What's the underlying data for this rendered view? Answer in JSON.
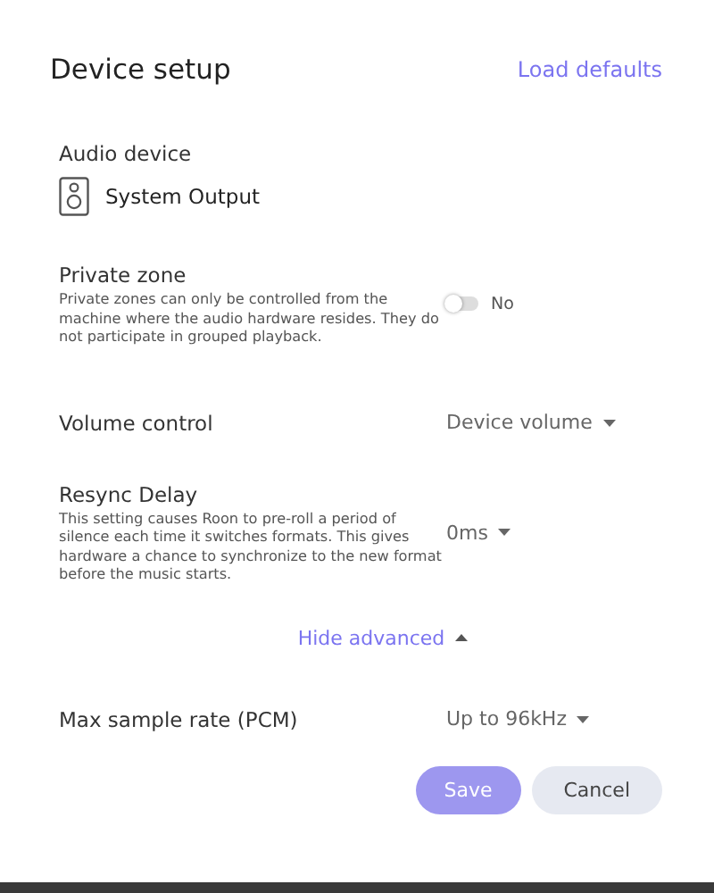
{
  "dialog": {
    "title": "Device setup",
    "load_defaults": "Load defaults"
  },
  "audio_device": {
    "label": "Audio device",
    "name": "System Output"
  },
  "settings": [
    {
      "kind": "toggle",
      "label": "Private zone",
      "description": "Private zones can only be controlled from the machine where the audio hardware resides. They do not participate in grouped playback.",
      "on": false,
      "value": "No"
    },
    {
      "kind": "dropdown",
      "label": "Volume control",
      "value": "Device volume"
    },
    {
      "kind": "dropdown",
      "label": "Resync Delay",
      "description": "This setting causes Roon to pre-roll a period of silence each time it switches formats. This gives hardware a chance to synchronize to the new format before the music starts.",
      "value": "0ms"
    }
  ],
  "advanced": {
    "label": "Hide advanced",
    "expanded": true
  },
  "advanced_settings": [
    {
      "kind": "dropdown",
      "label": "Max sample rate (PCM)",
      "value": "Up to 96kHz"
    }
  ],
  "buttons": [
    {
      "label": "Save",
      "kind": "primary",
      "disabled": true
    },
    {
      "label": "Cancel",
      "kind": "secondary",
      "disabled": false
    }
  ]
}
